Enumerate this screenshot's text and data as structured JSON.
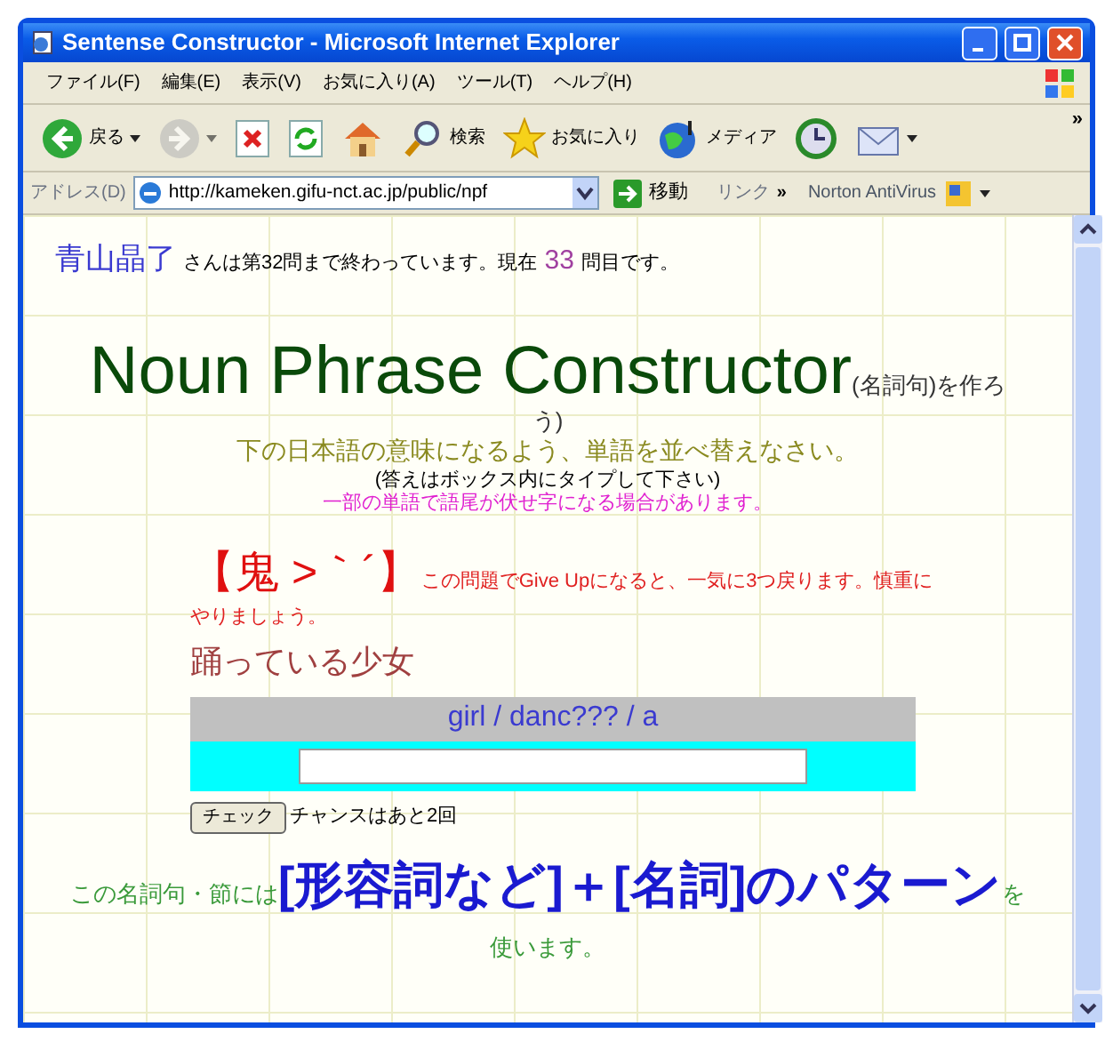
{
  "window": {
    "title": "Sentense Constructor - Microsoft Internet Explorer"
  },
  "menu": [
    "ファイル(F)",
    "編集(E)",
    "表示(V)",
    "お気に入り(A)",
    "ツール(T)",
    "ヘルプ(H)"
  ],
  "toolbar": [
    {
      "kind": "back",
      "label": "戻る",
      "dropdown": true,
      "disabled": false
    },
    {
      "kind": "forward",
      "dropdown": true,
      "disabled": true
    },
    {
      "kind": "stop",
      "disabled": false
    },
    {
      "kind": "refresh",
      "disabled": false
    },
    {
      "kind": "home",
      "disabled": false
    },
    {
      "kind": "search",
      "label": "検索",
      "disabled": false
    },
    {
      "kind": "favorites",
      "label": "お気に入り",
      "disabled": false
    },
    {
      "kind": "media",
      "label": "メディア",
      "disabled": false
    },
    {
      "kind": "history",
      "disabled": false
    },
    {
      "kind": "mail",
      "dropdown": true,
      "disabled": false
    }
  ],
  "toolbar_more": "»",
  "address_bar": {
    "label": "アドレス(D)",
    "url": "http://kameken.gifu-nct.ac.jp/public/npf",
    "go": "移動",
    "links": "リンク",
    "links_more": "»",
    "norton": "Norton AntiVirus"
  },
  "progress": {
    "user_name": "青山晶了",
    "before": "さんは第32問まで終わっています。現在",
    "current": "33",
    "after": "問目です。"
  },
  "heading": {
    "title": "Noun Phrase Constructor",
    "suffix": "(名詞句)を作ろう)"
  },
  "instruction": "下の日本語の意味になるよう、単語を並べ替えなさい。",
  "note": "(答えはボックス内にタイプして下さい)",
  "hint": "一部の単語で語尾が伏せ字になる場合があります。",
  "warning": {
    "badge": "【鬼 >｀´】",
    "text": "この問題でGive Upになると、一気に3つ戻ります。慎重にやりましょう。"
  },
  "prompt": "踊っている少女",
  "words": "girl / danc??? / a",
  "check_button": "チェック",
  "chances": "チャンスはあと2回",
  "pattern": {
    "before": "この名詞句・節には",
    "pattern": "[形容詞など]＋[名詞]のパターン",
    "after": "を使います。"
  }
}
